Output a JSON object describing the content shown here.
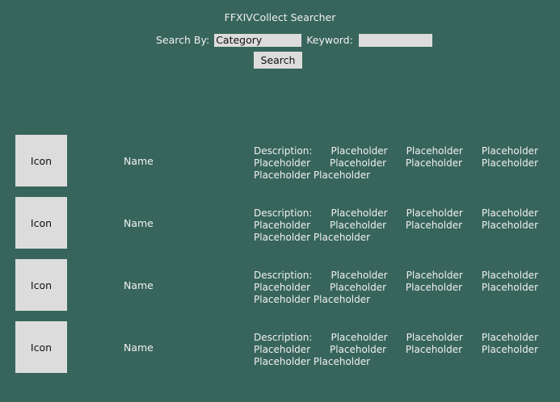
{
  "header": {
    "title": "FFXIVCollect Searcher"
  },
  "search": {
    "search_by_label": "Search By:",
    "category_value": "Category",
    "keyword_label": "Keyword:",
    "keyword_value": "",
    "button_label": "Search"
  },
  "results": [
    {
      "icon_label": "Icon",
      "name": "Name",
      "description": "Description: Placeholder Placeholder Placeholder Placeholder Placeholder Placeholder Placeholder Placeholder Placeholder"
    },
    {
      "icon_label": "Icon",
      "name": "Name",
      "description": "Description: Placeholder Placeholder Placeholder Placeholder Placeholder Placeholder Placeholder Placeholder Placeholder"
    },
    {
      "icon_label": "Icon",
      "name": "Name",
      "description": "Description: Placeholder Placeholder Placeholder Placeholder Placeholder Placeholder Placeholder Placeholder Placeholder"
    },
    {
      "icon_label": "Icon",
      "name": "Name",
      "description": "Description: Placeholder Placeholder Placeholder Placeholder Placeholder Placeholder Placeholder Placeholder Placeholder"
    }
  ],
  "colors": {
    "background": "#37655b",
    "control_fill": "#dcdcdc",
    "text_light": "#f0f0f0"
  }
}
